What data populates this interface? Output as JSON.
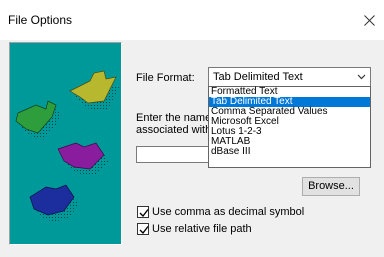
{
  "window": {
    "title": "File Options"
  },
  "fields": {
    "file_format_label": "File Format:",
    "file_format_value": "Tab Delimited Text",
    "instructions_line1": "Enter the name o",
    "instructions_line2": "associated with t",
    "filename_value": ""
  },
  "dropdown_options": [
    "Formatted Text",
    "Tab Delimited Text",
    "Comma Separated Values",
    "Microsoft Excel",
    "Lotus 1-2-3",
    "MATLAB",
    "dBase III"
  ],
  "buttons": {
    "browse": "Browse..."
  },
  "checkboxes": {
    "comma_decimal": {
      "label": "Use comma as decimal symbol",
      "checked": true
    },
    "relative_path": {
      "label": "Use relative file path",
      "checked": true
    }
  },
  "colors": {
    "panel_bg": "#00999A",
    "puzzle_yellow": "#B8B82E",
    "puzzle_green": "#2E9E3C",
    "puzzle_purple": "#8A1C9E",
    "puzzle_blue": "#1C2E9E",
    "selection": "#0078D7"
  },
  "icons": [
    "close-icon",
    "chevron-down-icon",
    "checkmark-icon",
    "puzzle-piece-icon"
  ]
}
